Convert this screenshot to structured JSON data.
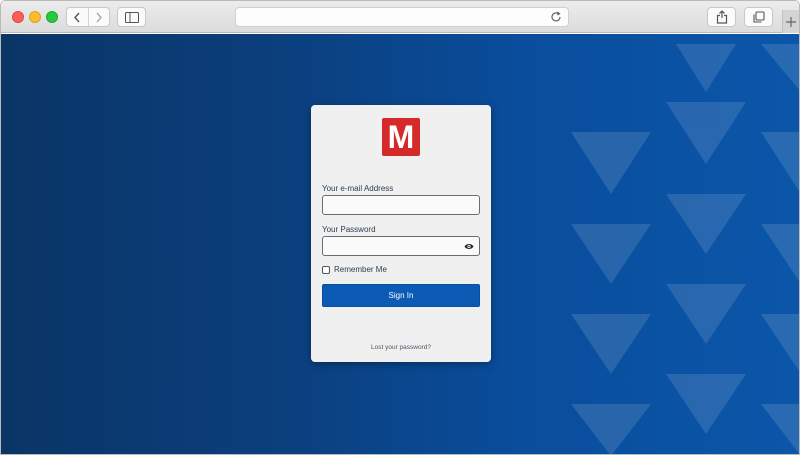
{
  "browser": {
    "address_value": "",
    "icons": {
      "back": "chevron-left-icon",
      "forward": "chevron-right-icon",
      "sidebar": "sidebar-icon",
      "reload": "reload-icon",
      "share": "share-icon",
      "tabs": "tabs-icon",
      "new_tab": "plus-icon"
    }
  },
  "login": {
    "logo_letter": "M",
    "email_label": "Your e-mail Address",
    "email_value": "",
    "password_label": "Your Password",
    "password_value": "",
    "remember_label": "Remember Me",
    "remember_checked": false,
    "signin_label": "Sign In",
    "lost_password": "Lost your password?"
  },
  "colors": {
    "brand_red": "#d42a2a",
    "button_blue": "#0b5ab3",
    "background_blue": "#0a4d9c"
  }
}
